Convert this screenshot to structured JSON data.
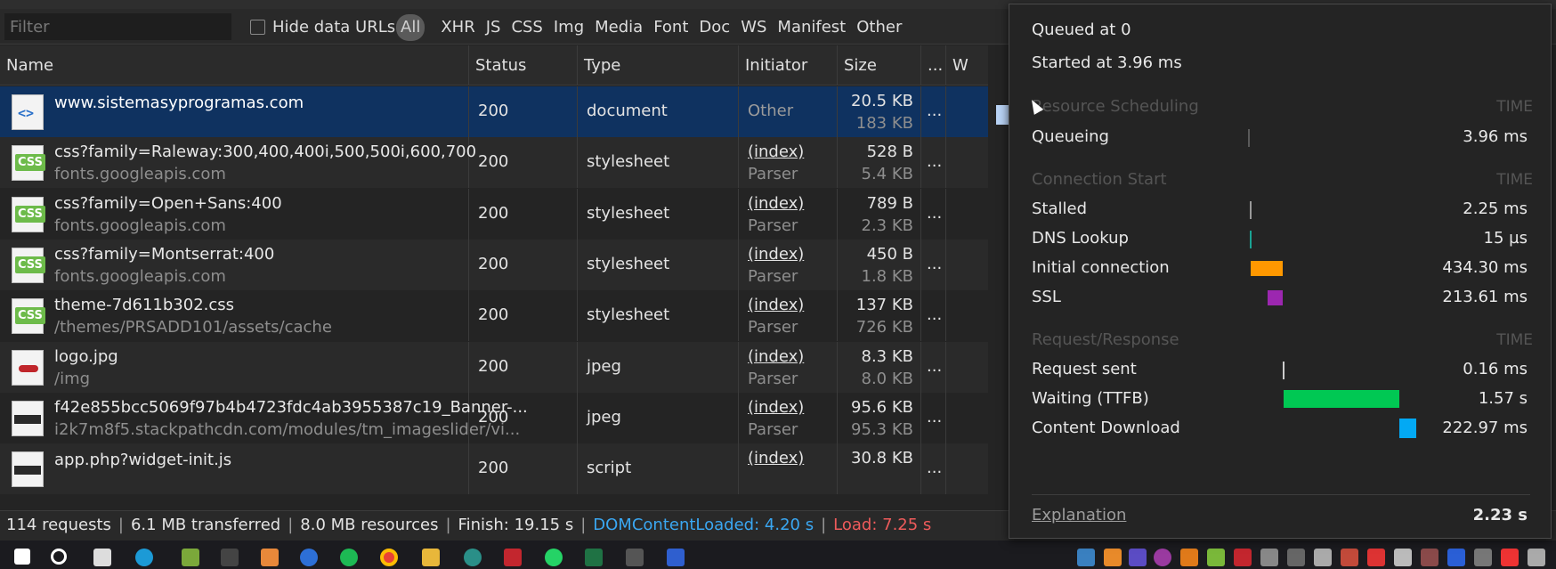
{
  "filter": {
    "placeholder": "Filter",
    "hide_data_urls": "Hide data URLs"
  },
  "type_filters": [
    "All",
    "XHR",
    "JS",
    "CSS",
    "Img",
    "Media",
    "Font",
    "Doc",
    "WS",
    "Manifest",
    "Other"
  ],
  "columns": {
    "name": "Name",
    "status": "Status",
    "type": "Type",
    "initiator": "Initiator",
    "size": "Size",
    "more": "...",
    "waterfall": "W"
  },
  "rows": [
    {
      "name": "www.sistemasyprogramas.com",
      "path": "",
      "status": "200",
      "type": "document",
      "initiator": "Other",
      "initiator_sub": "",
      "size": "20.5 KB",
      "resource": "183 KB",
      "icon": "doc-icon"
    },
    {
      "name": "css?family=Raleway:300,400,400i,500,500i,600,700",
      "path": "fonts.googleapis.com",
      "status": "200",
      "type": "stylesheet",
      "initiator": "(index)",
      "initiator_sub": "Parser",
      "size": "528 B",
      "resource": "5.4 KB",
      "icon": "css-icon"
    },
    {
      "name": "css?family=Open+Sans:400",
      "path": "fonts.googleapis.com",
      "status": "200",
      "type": "stylesheet",
      "initiator": "(index)",
      "initiator_sub": "Parser",
      "size": "789 B",
      "resource": "2.3 KB",
      "icon": "css-icon"
    },
    {
      "name": "css?family=Montserrat:400",
      "path": "fonts.googleapis.com",
      "status": "200",
      "type": "stylesheet",
      "initiator": "(index)",
      "initiator_sub": "Parser",
      "size": "450 B",
      "resource": "1.8 KB",
      "icon": "css-icon"
    },
    {
      "name": "theme-7d611b302.css",
      "path": "/themes/PRSADD101/assets/cache",
      "status": "200",
      "type": "stylesheet",
      "initiator": "(index)",
      "initiator_sub": "Parser",
      "size": "137 KB",
      "resource": "726 KB",
      "icon": "css-icon"
    },
    {
      "name": "logo.jpg",
      "path": "/img",
      "status": "200",
      "type": "jpeg",
      "initiator": "(index)",
      "initiator_sub": "Parser",
      "size": "8.3 KB",
      "resource": "8.0 KB",
      "icon": "image-icon"
    },
    {
      "name": "f42e855bcc5069f97b4b4723fdc4ab3955387c19_Banner-...",
      "path": "i2k7m8f5.stackpathcdn.com/modules/tm_imageslider/vi...",
      "status": "200",
      "type": "jpeg",
      "initiator": "(index)",
      "initiator_sub": "Parser",
      "size": "95.6 KB",
      "resource": "95.3 KB",
      "icon": "image-icon"
    },
    {
      "name": "app.php?widget-init.js",
      "path": "",
      "status": "200",
      "type": "script",
      "initiator": "(index)",
      "initiator_sub": "",
      "size": "30.8 KB",
      "resource": "",
      "icon": "script-icon"
    }
  ],
  "more_cell": "...",
  "status": {
    "requests": "114 requests",
    "transferred": "6.1 MB transferred",
    "resources": "8.0 MB resources",
    "finish": "Finish: 19.15 s",
    "dcl": "DOMContentLoaded: 4.20 s",
    "load": "Load: 7.25 s",
    "sep": "|"
  },
  "timing": {
    "queued_at": "Queued at 0",
    "started_at": "Started at 3.96 ms",
    "time_label": "TIME",
    "sections": [
      {
        "title": "Resource Scheduling",
        "items": [
          {
            "label": "Queueing",
            "value": "3.96 ms",
            "color": "#5a5a5a",
            "start": 0,
            "end": 0.6
          }
        ]
      },
      {
        "title": "Connection Start",
        "items": [
          {
            "label": "Stalled",
            "value": "2.25 ms",
            "color": "#9a9a9a",
            "start": 0.6,
            "end": 0.8
          },
          {
            "label": "DNS Lookup",
            "value": "15 µs",
            "color": "#1aa393",
            "start": 0.8,
            "end": 1.1
          },
          {
            "label": "Initial connection",
            "value": "434.30 ms",
            "color": "#ff9800",
            "start": 1.1,
            "end": 13.1
          },
          {
            "label": "SSL",
            "value": "213.61 ms",
            "color": "#9c27b0",
            "start": 7.2,
            "end": 13.1
          }
        ]
      },
      {
        "title": "Request/Response",
        "items": [
          {
            "label": "Request sent",
            "value": "0.16 ms",
            "color": "#cccccc",
            "start": 13.1,
            "end": 13.3
          },
          {
            "label": "Waiting (TTFB)",
            "value": "1.57 s",
            "color": "#00c853",
            "start": 13.3,
            "end": 56.8
          },
          {
            "label": "Content Download",
            "value": "222.97 ms",
            "color": "#03a9f4",
            "start": 56.8,
            "end": 63.0
          }
        ]
      }
    ],
    "explanation": "Explanation",
    "total": "2.23 s",
    "scale_max": 100
  }
}
